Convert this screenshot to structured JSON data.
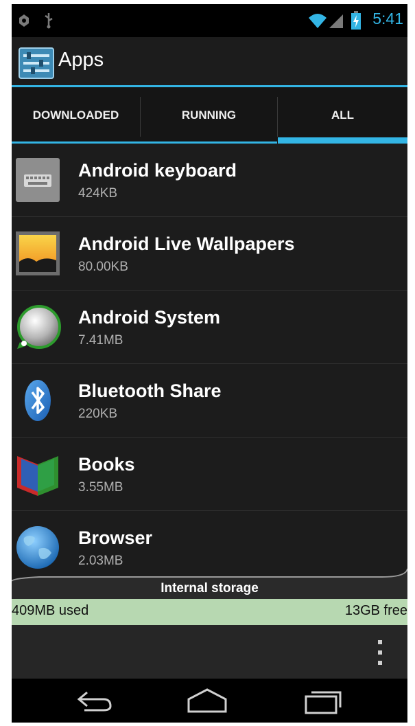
{
  "status_bar": {
    "time": "5:41",
    "left_icons": [
      "android-debug-icon",
      "usb-icon"
    ],
    "right_icons": [
      "wifi-icon",
      "signal-icon",
      "battery-icon"
    ]
  },
  "action_bar": {
    "title": "Apps",
    "icon": "settings-apps-icon"
  },
  "tabs": [
    {
      "label": "DOWNLOADED",
      "selected": false
    },
    {
      "label": "RUNNING",
      "selected": false
    },
    {
      "label": "ALL",
      "selected": true
    }
  ],
  "apps": [
    {
      "name": "Android keyboard",
      "size": "424KB",
      "icon": "keyboard-icon"
    },
    {
      "name": "Android Live Wallpapers",
      "size": "80.00KB",
      "icon": "live-wallpaper-icon"
    },
    {
      "name": "Android System",
      "size": "7.41MB",
      "icon": "android-system-icon"
    },
    {
      "name": "Bluetooth Share",
      "size": "220KB",
      "icon": "bluetooth-icon"
    },
    {
      "name": "Books",
      "size": "3.55MB",
      "icon": "books-icon"
    },
    {
      "name": "Browser",
      "size": "2.03MB",
      "icon": "browser-globe-icon"
    }
  ],
  "storage": {
    "label": "Internal storage",
    "used": "409MB used",
    "free": "13GB free"
  },
  "bottom_bar": {
    "menu_icon": "overflow-menu-icon"
  },
  "nav_bar": {
    "buttons": [
      "back-icon",
      "home-icon",
      "recent-apps-icon"
    ]
  },
  "colors": {
    "accent": "#33b5e5",
    "storage_bar": "#b7d8b1",
    "background": "#1c1c1c"
  }
}
